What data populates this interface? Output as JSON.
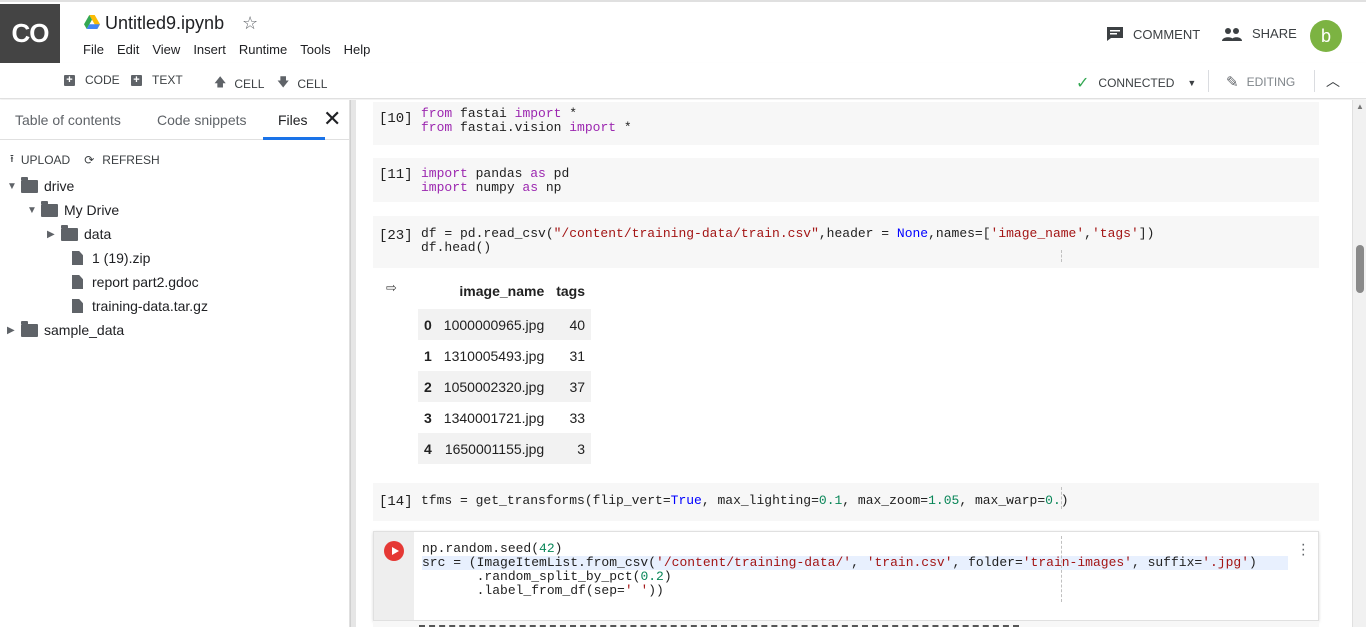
{
  "header": {
    "logo_text": "CO",
    "title": "Untitled9.ipynb",
    "menu": [
      "File",
      "Edit",
      "View",
      "Insert",
      "Runtime",
      "Tools",
      "Help"
    ],
    "comment_label": "COMMENT",
    "share_label": "SHARE",
    "avatar_letter": "b"
  },
  "toolbar": {
    "code_label": "CODE",
    "text_label": "TEXT",
    "cell_up_label": "CELL",
    "cell_down_label": "CELL",
    "status_label": "CONNECTED",
    "mode_label": "EDITING"
  },
  "sidepanel": {
    "tabs": [
      "Table of contents",
      "Code snippets",
      "Files"
    ],
    "upload_label": "UPLOAD",
    "refresh_label": "REFRESH",
    "tree": [
      {
        "label": "drive"
      },
      {
        "label": "My Drive"
      },
      {
        "label": "data"
      },
      {
        "label": "1 (19).zip"
      },
      {
        "label": "report part2.gdoc"
      },
      {
        "label": "training-data.tar.gz"
      },
      {
        "label": "sample_data"
      }
    ]
  },
  "cells": [
    {
      "num": "[10]"
    },
    {
      "num": "[11]"
    },
    {
      "num": "[23]"
    },
    {
      "num": "[14]"
    }
  ],
  "table": {
    "headers": [
      "",
      "image_name",
      "tags"
    ],
    "rows": [
      [
        "0",
        "1000000965.jpg",
        "40"
      ],
      [
        "1",
        "1310005493.jpg",
        "31"
      ],
      [
        "2",
        "1050002320.jpg",
        "37"
      ],
      [
        "3",
        "1340001721.jpg",
        "33"
      ],
      [
        "4",
        "1650001155.jpg",
        "3"
      ]
    ]
  },
  "colors": {
    "accent": "#1a73e8",
    "run_button": "#e53935",
    "connected_check": "#34a853",
    "avatar": "#7cb342",
    "logo_bg": "#444444"
  }
}
